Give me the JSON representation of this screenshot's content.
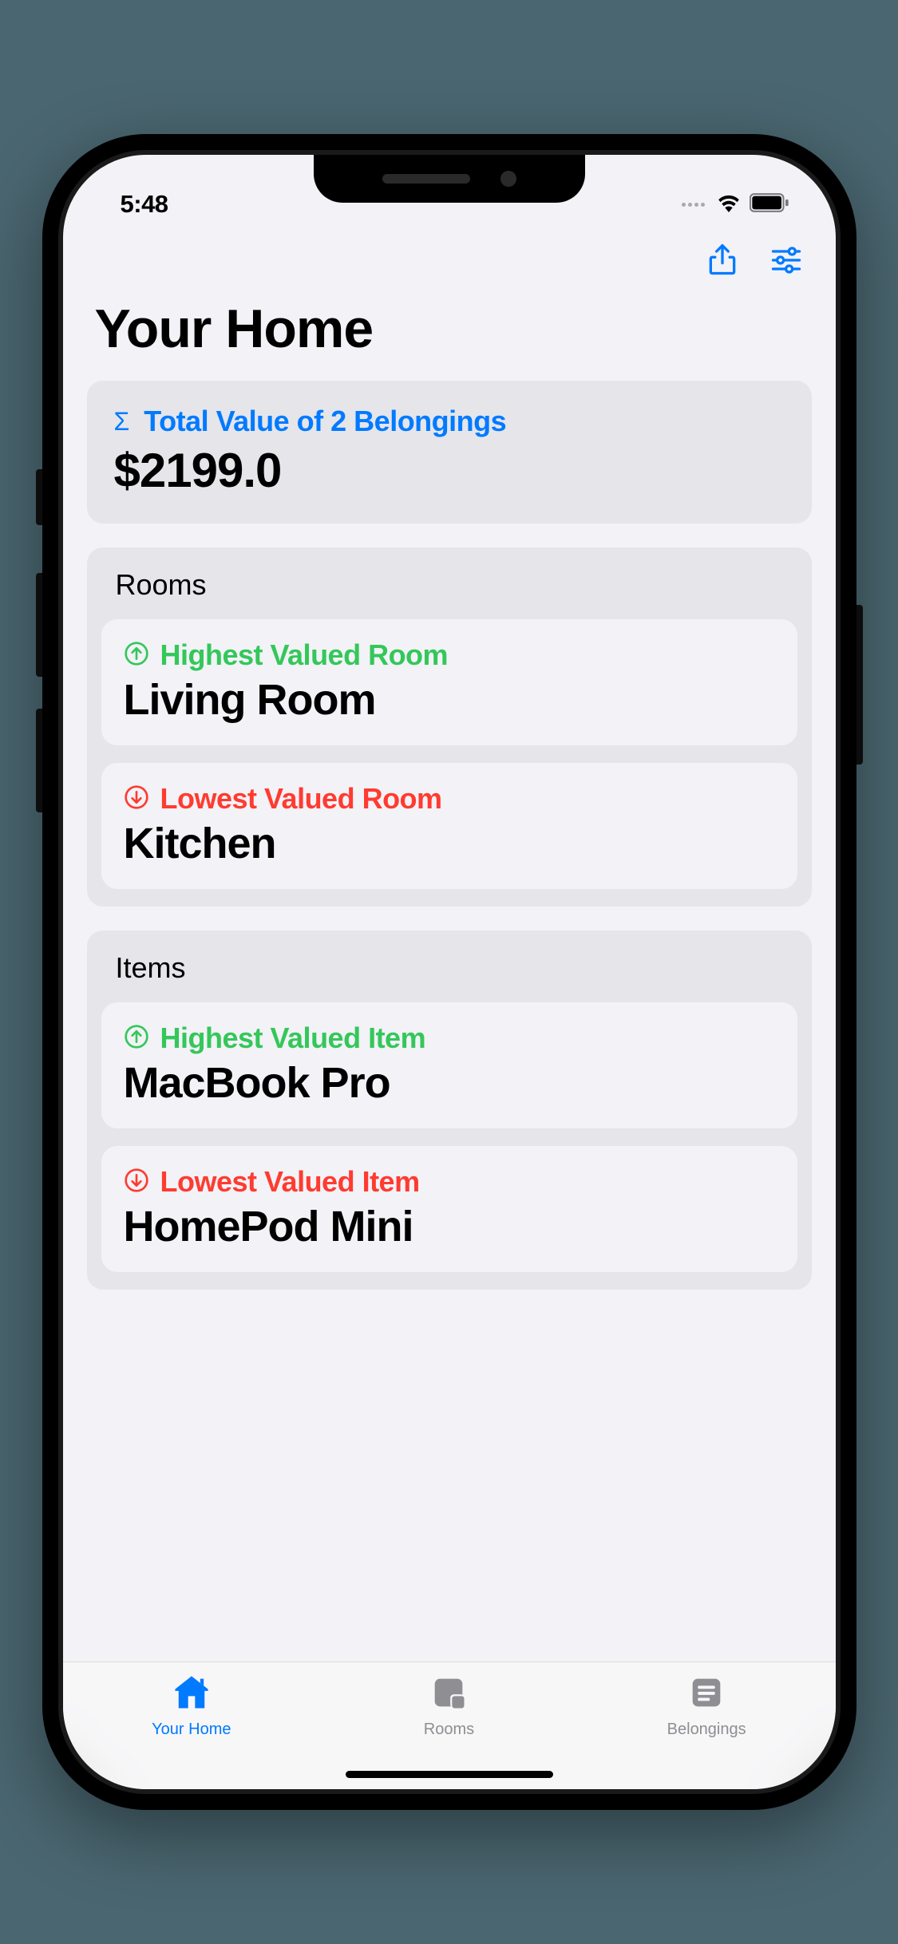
{
  "status": {
    "time": "5:48"
  },
  "page": {
    "title": "Your Home"
  },
  "summary": {
    "label": "Total Value of 2 Belongings",
    "value": "$2199.0"
  },
  "sections": {
    "rooms": {
      "heading": "Rooms",
      "highest": {
        "label": "Highest Valued Room",
        "value": "Living Room"
      },
      "lowest": {
        "label": "Lowest Valued Room",
        "value": "Kitchen"
      }
    },
    "items": {
      "heading": "Items",
      "highest": {
        "label": "Highest Valued Item",
        "value": "MacBook Pro"
      },
      "lowest": {
        "label": "Lowest Valued Item",
        "value": "HomePod Mini"
      }
    }
  },
  "tabs": {
    "home": "Your Home",
    "rooms": "Rooms",
    "belongings": "Belongings"
  }
}
